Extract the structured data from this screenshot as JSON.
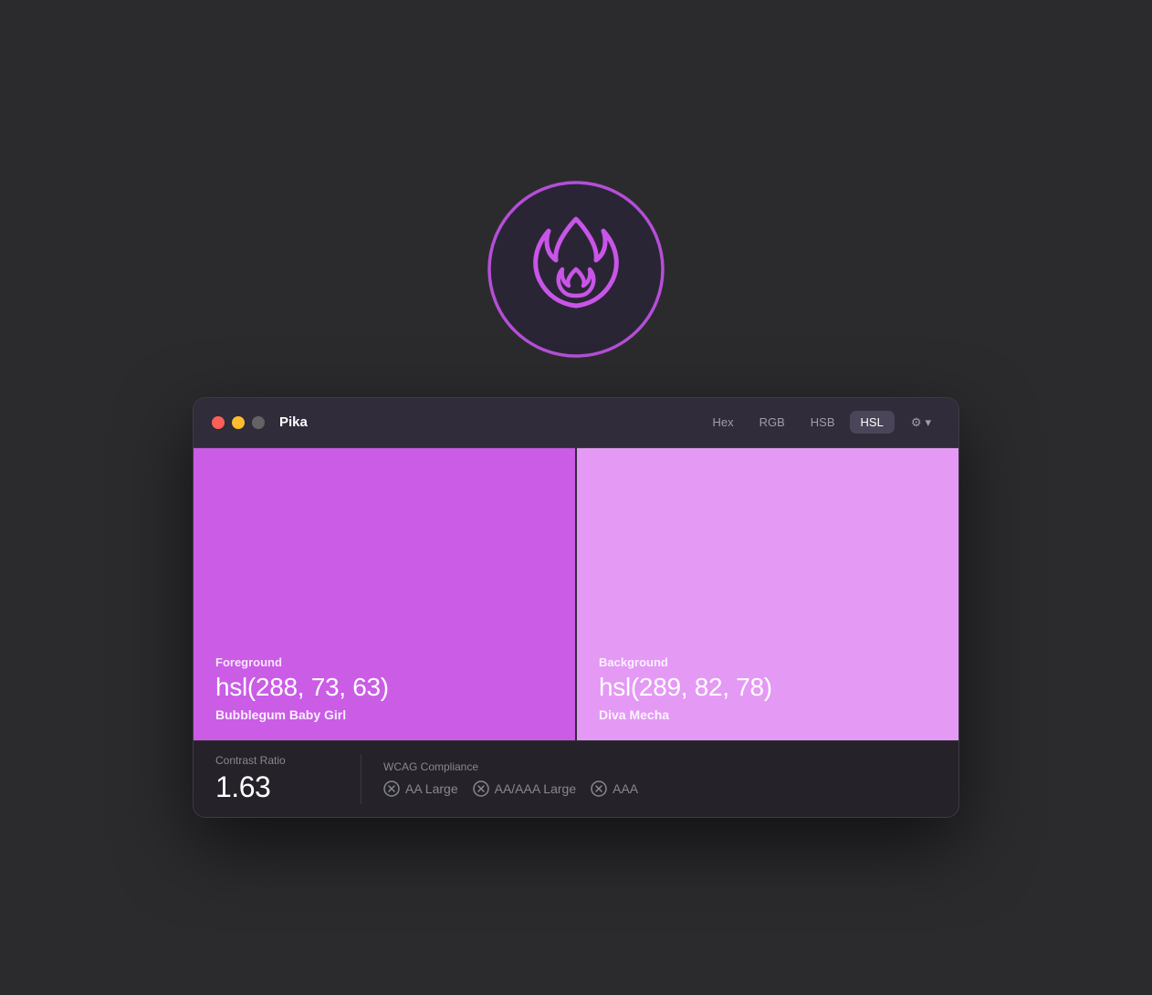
{
  "app_icon": {
    "description": "Pika flame icon"
  },
  "window": {
    "title": "Pika",
    "format_tabs": [
      {
        "label": "Hex",
        "active": false
      },
      {
        "label": "RGB",
        "active": false
      },
      {
        "label": "HSB",
        "active": false
      },
      {
        "label": "HSL",
        "active": true
      }
    ],
    "settings_label": "⚙",
    "chevron_label": "▾"
  },
  "foreground": {
    "label": "Foreground",
    "value": "hsl(288, 73, 63)",
    "name": "Bubblegum Baby Girl"
  },
  "background": {
    "label": "Background",
    "value": "hsl(289, 82, 78)",
    "name": "Diva Mecha"
  },
  "contrast": {
    "section_label": "Contrast Ratio",
    "value": "1.63"
  },
  "wcag": {
    "section_label": "WCAG Compliance",
    "badges": [
      {
        "label": "AA Large"
      },
      {
        "label": "AA/AAA Large"
      },
      {
        "label": "AAA"
      }
    ]
  },
  "traffic_lights": {
    "red": "#ff5f57",
    "yellow": "#febc2e",
    "gray": "#636366"
  }
}
